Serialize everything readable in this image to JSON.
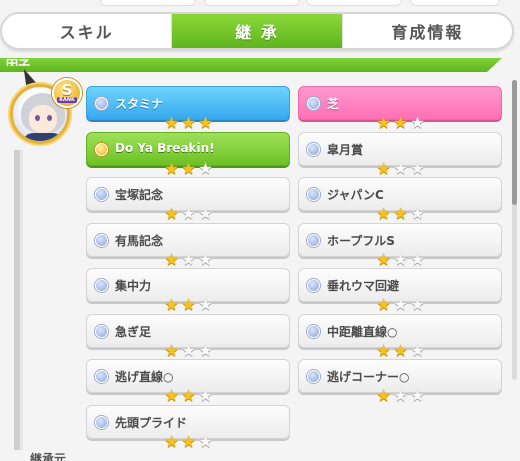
{
  "tabs": [
    {
      "label": "スキル",
      "active": false
    },
    {
      "label": "継 承",
      "active": true
    },
    {
      "label": "育成情報",
      "active": false
    }
  ],
  "section_title": "因子",
  "rank": {
    "letter": "S",
    "text": "RANK"
  },
  "colors": {
    "accent_green": "#6cc125",
    "blue_factor": "#36a8ee",
    "pink_factor": "#ff6fb4",
    "star_on": "#f6c21c"
  },
  "factors": [
    {
      "label": "スタミナ",
      "stars": 3,
      "type": "blue"
    },
    {
      "label": "芝",
      "stars": 2,
      "type": "pink"
    },
    {
      "label": "Do Ya Breakin!",
      "stars": 2,
      "type": "green"
    },
    {
      "label": "皐月賞",
      "stars": 1,
      "type": "white"
    },
    {
      "label": "宝塚記念",
      "stars": 1,
      "type": "white"
    },
    {
      "label": "ジャパンC",
      "stars": 2,
      "type": "white"
    },
    {
      "label": "有馬記念",
      "stars": 1,
      "type": "white"
    },
    {
      "label": "ホープフルS",
      "stars": 1,
      "type": "white"
    },
    {
      "label": "集中力",
      "stars": 2,
      "type": "white"
    },
    {
      "label": "垂れウマ回避",
      "stars": 1,
      "type": "white"
    },
    {
      "label": "急ぎ足",
      "stars": 1,
      "type": "white"
    },
    {
      "label": "中距離直線○",
      "stars": 2,
      "type": "white"
    },
    {
      "label": "逃げ直線○",
      "stars": 2,
      "type": "white"
    },
    {
      "label": "逃げコーナー○",
      "stars": 1,
      "type": "white"
    },
    {
      "label": "先頭プライド",
      "stars": 2,
      "type": "white"
    }
  ],
  "footer_label": "継承元"
}
